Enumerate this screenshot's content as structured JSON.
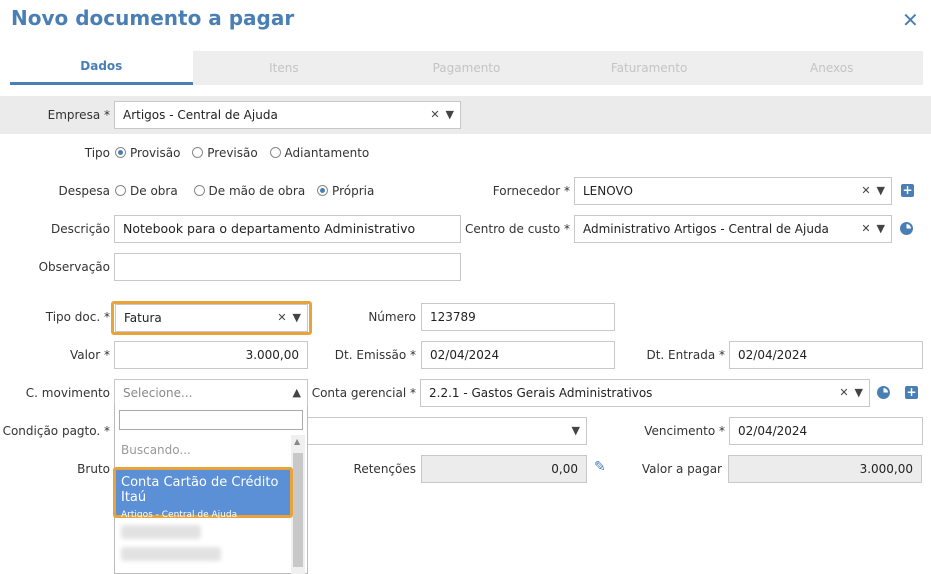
{
  "dialog": {
    "title": "Novo documento a pagar",
    "close_glyph": "✕"
  },
  "tabs": [
    {
      "label": "Dados",
      "active": true
    },
    {
      "label": "Itens",
      "active": false
    },
    {
      "label": "Pagamento",
      "active": false
    },
    {
      "label": "Faturamento",
      "active": false
    },
    {
      "label": "Anexos",
      "active": false
    }
  ],
  "form": {
    "empresa": {
      "label": "Empresa *",
      "value": "Artigos - Central de Ajuda"
    },
    "tipo": {
      "label": "Tipo",
      "options": [
        "Provisão",
        "Previsão",
        "Adiantamento"
      ],
      "selected": "Provisão"
    },
    "despesa": {
      "label": "Despesa",
      "options": [
        "De obra",
        "De mão de obra",
        "Própria"
      ],
      "selected": "Própria"
    },
    "fornecedor": {
      "label": "Fornecedor *",
      "value": "LENOVO"
    },
    "descricao": {
      "label": "Descrição",
      "value": "Notebook para o departamento Administrativo"
    },
    "centro_custo": {
      "label": "Centro de custo *",
      "value": "Administrativo Artigos - Central de Ajuda"
    },
    "observacao": {
      "label": "Observação",
      "value": ""
    },
    "tipo_doc": {
      "label": "Tipo doc. *",
      "value": "Fatura"
    },
    "numero": {
      "label": "Número",
      "value": "123789"
    },
    "valor": {
      "label": "Valor *",
      "value": "3.000,00"
    },
    "dt_emissao": {
      "label": "Dt. Emissão *",
      "value": "02/04/2024"
    },
    "dt_entrada": {
      "label": "Dt. Entrada *",
      "value": "02/04/2024"
    },
    "c_movimento": {
      "label": "C. movimento",
      "placeholder": "Selecione..."
    },
    "conta_gerencial": {
      "label": "Conta gerencial *",
      "value": "2.2.1 - Gastos Gerais Administrativos"
    },
    "condicao_pagto": {
      "label": "Condição pagto. *",
      "value": ""
    },
    "vencimento": {
      "label": "Vencimento *",
      "value": "02/04/2024"
    },
    "bruto": {
      "label": "Bruto"
    },
    "retencoes": {
      "label": "Retenções",
      "value": "0,00"
    },
    "valor_pagar": {
      "label": "Valor a pagar",
      "value": "3.000,00"
    }
  },
  "dropdown": {
    "loading": "Buscando...",
    "option": {
      "title": "Conta Cartão de Crédito Itaú",
      "subtitle": "Artigos - Central de Ajuda"
    }
  },
  "colors": {
    "accent": "#4a7fb5",
    "highlight": "#e8a33a",
    "option_bg": "#5b8fd6"
  }
}
